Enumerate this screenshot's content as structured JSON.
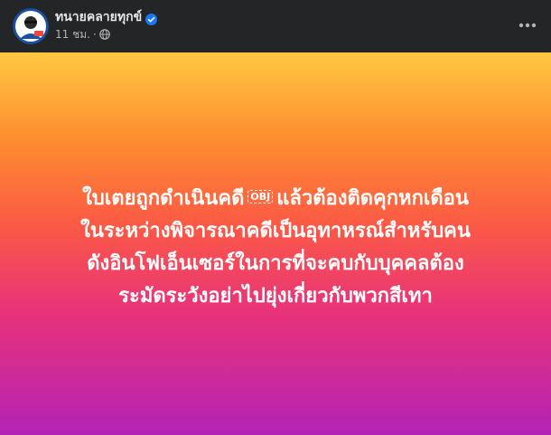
{
  "post": {
    "author_name": "ทนายคลายทุกข์",
    "timestamp": "11 ชม.",
    "separator": "·",
    "privacy_icon": "globe-icon",
    "verified_icon": "verified-badge-icon",
    "more_icon": "more-options-icon"
  },
  "card": {
    "lines": [
      {
        "before": "ใบเตยถูกดำเนินคดี",
        "obj": "OBJ",
        "after": "แล้วต้องติดคุกหกเดือน"
      },
      {
        "text": "ในระหว่างพิจารณาคดีเป็นอุทาหรณ์สำหรับคน"
      },
      {
        "text": "ดังอินโฟเอ็นเซอร์ในการที่จะคบกับบุคคลต้อง"
      },
      {
        "text": "ระมัดระวังอย่าไปยุ่งเกี่ยวกับพวกสีเทา"
      }
    ],
    "text_color": "#ffffff",
    "gradient": [
      "#ffc843",
      "#fe8f2f",
      "#fb5a45",
      "#e8327a",
      "#b323b5"
    ]
  },
  "colors": {
    "background": "#242526",
    "name": "#e4e6eb",
    "meta": "#b0b3b8",
    "verified": "#1877f2"
  }
}
